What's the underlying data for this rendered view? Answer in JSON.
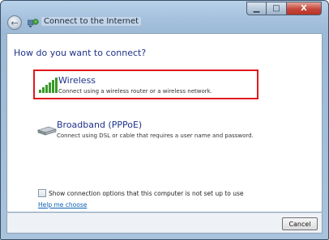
{
  "window": {
    "title": "Connect to the Internet",
    "back_glyph": "←",
    "minimize_glyph": "▁",
    "maximize_glyph": "□",
    "close_glyph": "X"
  },
  "content": {
    "heading": "How do you want to connect?",
    "options": [
      {
        "title": "Wireless",
        "description": "Connect using a wireless router or a wireless network.",
        "icon": "wireless-signal-icon",
        "selected": true
      },
      {
        "title": "Broadband (PPPoE)",
        "description": "Connect using DSL or cable that requires a user name and password.",
        "icon": "broadband-modem-icon",
        "selected": false
      }
    ],
    "show_options_checkbox_label": "Show connection options that this computer is not set up to use",
    "show_options_checked": false,
    "help_link": "Help me choose"
  },
  "footer": {
    "cancel_label": "Cancel"
  },
  "colors": {
    "selection_border": "#e2181d",
    "heading": "#1e3287",
    "link": "#0b5fb4"
  }
}
